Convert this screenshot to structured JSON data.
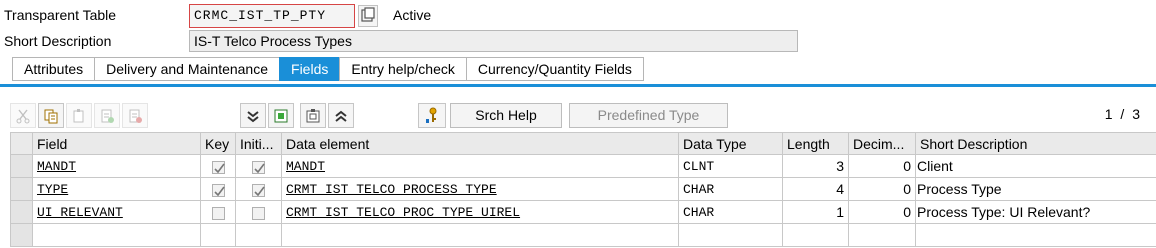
{
  "header": {
    "table_type_label": "Transparent Table",
    "table_name": "CRMC_IST_TP_PTY",
    "status": "Active",
    "short_desc_label": "Short Description",
    "short_desc_value": "IS-T Telco Process Types"
  },
  "tabs": [
    {
      "label": "Attributes",
      "active": false
    },
    {
      "label": "Delivery and Maintenance",
      "active": false
    },
    {
      "label": "Fields",
      "active": true
    },
    {
      "label": "Entry help/check",
      "active": false
    },
    {
      "label": "Currency/Quantity Fields",
      "active": false
    }
  ],
  "toolbar": {
    "srch_help_label": "Srch Help",
    "predefined_type_label": "Predefined Type",
    "page_indicator": "1 / 3",
    "icons": [
      "cut-icon",
      "copy-icon",
      "paste-icon",
      "insert-row-icon",
      "delete-row-icon",
      "collapse-icon",
      "new-field-icon",
      "include-icon",
      "expand-icon",
      "search-help-icon"
    ]
  },
  "grid": {
    "columns": [
      "Field",
      "Key",
      "Initi...",
      "Data element",
      "Data Type",
      "Length",
      "Decim...",
      "Short Description"
    ],
    "rows": [
      {
        "field": "MANDT",
        "key": true,
        "initial": true,
        "data_element": "MANDT",
        "data_type": "CLNT",
        "length": "3",
        "decimals": "0",
        "short_desc": "Client"
      },
      {
        "field": "TYPE",
        "key": true,
        "initial": true,
        "data_element": "CRMT_IST_TELCO_PROCESS_TYPE",
        "data_type": "CHAR",
        "length": "4",
        "decimals": "0",
        "short_desc": "Process Type"
      },
      {
        "field": "UI_RELEVANT",
        "key": false,
        "initial": false,
        "data_element": "CRMT_IST_TELCO_PROC_TYPE_UIREL",
        "data_type": "CHAR",
        "length": "1",
        "decimals": "0",
        "short_desc": "Process Type: UI Relevant?"
      }
    ]
  }
}
